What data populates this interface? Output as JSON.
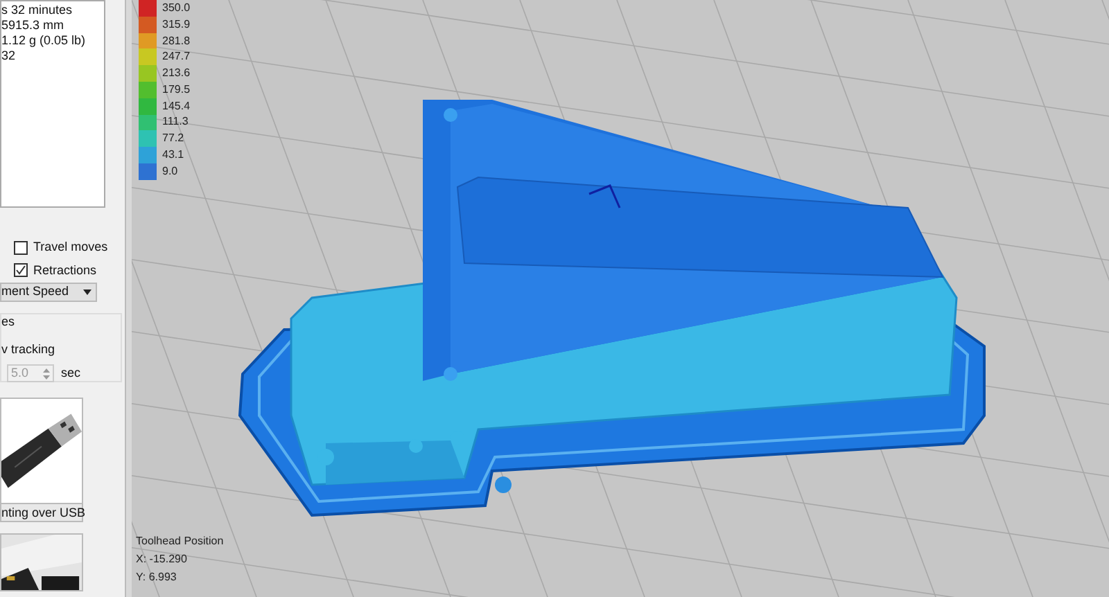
{
  "stats": [
    "s 32 minutes",
    "5915.3 mm",
    "1.12 g (0.05 lb)",
    "32"
  ],
  "options": [
    {
      "label": "Travel moves",
      "checked": false
    },
    {
      "label": "Retractions",
      "checked": true
    }
  ],
  "color_by": {
    "value": "ment Speed"
  },
  "group": {
    "title": "es",
    "follow_label": "v tracking",
    "spin_value": "5.0",
    "spin_disabled": true,
    "unit": "sec"
  },
  "cards": [
    {
      "kind": "picture",
      "caption": "nting over USB"
    },
    {
      "kind": "picture"
    }
  ],
  "legend": [
    {
      "label": "350.0",
      "color": "#d02424"
    },
    {
      "label": "315.9",
      "color": "#d45a22"
    },
    {
      "label": "281.8",
      "color": "#e09a24"
    },
    {
      "label": "247.7",
      "color": "#c8c822"
    },
    {
      "label": "213.6",
      "color": "#98c622"
    },
    {
      "label": "179.5",
      "color": "#52be2e"
    },
    {
      "label": "145.4",
      "color": "#30b840"
    },
    {
      "label": "111.3",
      "color": "#30c072"
    },
    {
      "label": "77.2",
      "color": "#2ec2b2"
    },
    {
      "label": "43.1",
      "color": "#2ea2d8"
    },
    {
      "label": "9.0",
      "color": "#2e72d2"
    }
  ],
  "toolhead": {
    "title": "Toolhead Position",
    "x": "X: -15.290",
    "y": "Y: 6.993"
  }
}
